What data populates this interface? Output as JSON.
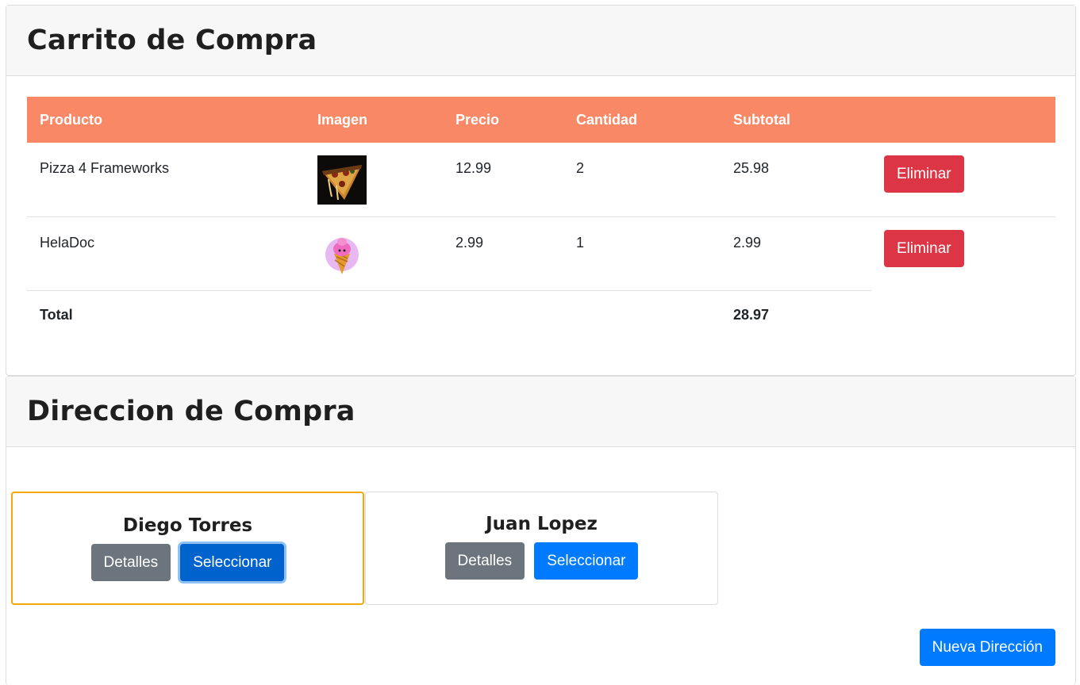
{
  "cart": {
    "title": "Carrito de Compra",
    "headers": {
      "product": "Producto",
      "image": "Imagen",
      "price": "Precio",
      "quantity": "Cantidad",
      "subtotal": "Subtotal"
    },
    "items": [
      {
        "product": "Pizza 4 Frameworks",
        "image_icon": "pizza-image",
        "price": "12.99",
        "quantity": "2",
        "subtotal": "25.98",
        "remove_label": "Eliminar"
      },
      {
        "product": "HelaDoc",
        "image_icon": "ice-cream-image",
        "price": "2.99",
        "quantity": "1",
        "subtotal": "2.99",
        "remove_label": "Eliminar"
      }
    ],
    "total_label": "Total",
    "total_value": "28.97",
    "colors": {
      "header_bg": "#f98866",
      "danger": "#dc3545"
    }
  },
  "address": {
    "title": "Direccion de Compra",
    "items": [
      {
        "name": "Diego Torres",
        "details_label": "Detalles",
        "select_label": "Seleccionar",
        "selected": true
      },
      {
        "name": "Juan Lopez",
        "details_label": "Detalles",
        "select_label": "Seleccionar",
        "selected": false
      }
    ],
    "new_address_label": "Nueva Dirección",
    "colors": {
      "selected_border": "#f5a800",
      "primary": "#007bff",
      "secondary": "#6c757d"
    }
  }
}
